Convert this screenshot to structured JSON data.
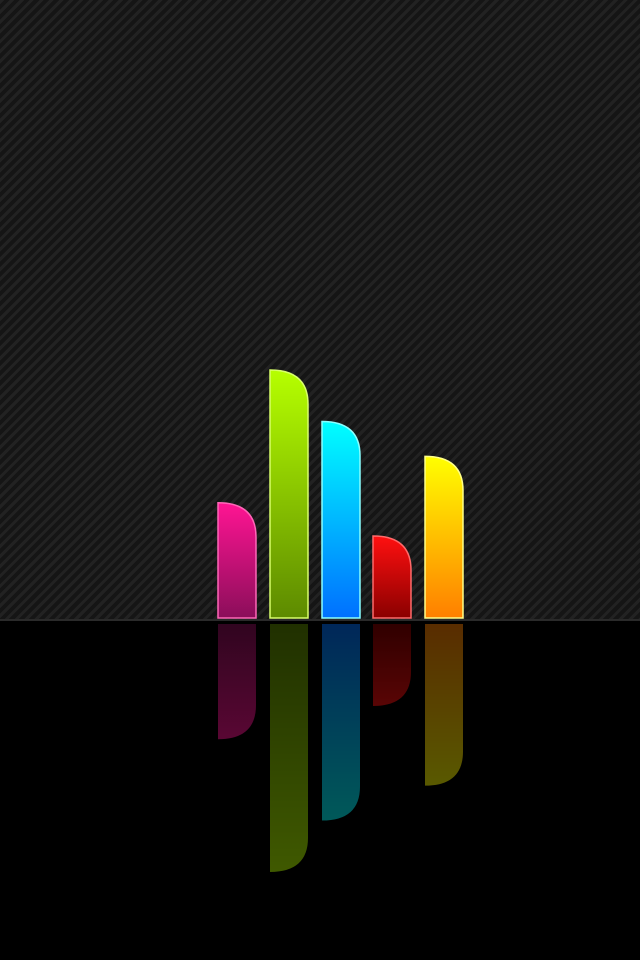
{
  "scene": {
    "background": {
      "upper": "#1b1b1b",
      "stripe": "#222222",
      "floor": "#000000"
    },
    "bars": [
      {
        "name": "magenta-bar",
        "top": "#ff1493",
        "bottom": "#8b0e5a",
        "edge": "#ff66b8",
        "level": 0.2
      },
      {
        "name": "lime-bar",
        "top": "#b6ff00",
        "bottom": "#5d8a00",
        "edge": "#d8ff6a",
        "level": 1.0
      },
      {
        "name": "cyan-bar",
        "top": "#00ffff",
        "bottom": "#0070ff",
        "edge": "#8affff",
        "level": 0.69
      },
      {
        "name": "red-bar",
        "top": "#ff1010",
        "bottom": "#8a0000",
        "edge": "#ff6a6a",
        "level": 0.0
      },
      {
        "name": "yellow-bar",
        "top": "#ffff00",
        "bottom": "#ff7f00",
        "edge": "#ffff88",
        "level": 0.48
      }
    ]
  }
}
